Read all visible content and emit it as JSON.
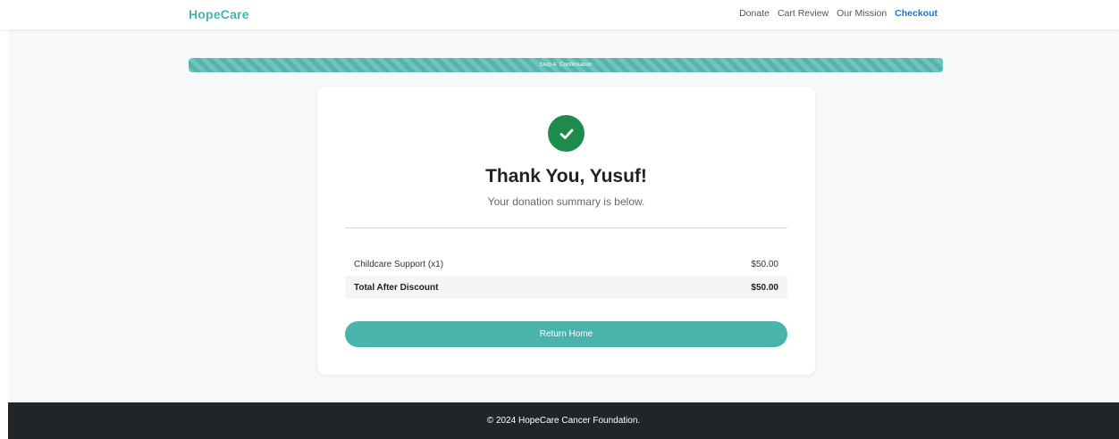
{
  "navbar": {
    "brand": "HopeCare",
    "links": [
      {
        "label": "Donate",
        "active": false
      },
      {
        "label": "Cart Review",
        "active": false
      },
      {
        "label": "Our Mission",
        "active": false
      },
      {
        "label": "Checkout",
        "active": true
      }
    ]
  },
  "progress": {
    "label": "Step 4: Confirmation",
    "percent": 100
  },
  "confirmation": {
    "icon": "check-circle-icon",
    "title": "Thank You, Yusuf!",
    "subtitle": "Your donation summary is below.",
    "line_items": [
      {
        "name": "Childcare Support (x1)",
        "amount": "$50.00"
      }
    ],
    "total": {
      "label": "Total After Discount",
      "amount": "$50.00"
    },
    "button_label": "Return Home"
  },
  "footer": {
    "text": "© 2024 HopeCare Cancer Foundation."
  },
  "colors": {
    "accent": "#4ab3ab",
    "success": "#1e8a4c",
    "active_link": "#1a73d9",
    "footer_bg": "#212529"
  }
}
